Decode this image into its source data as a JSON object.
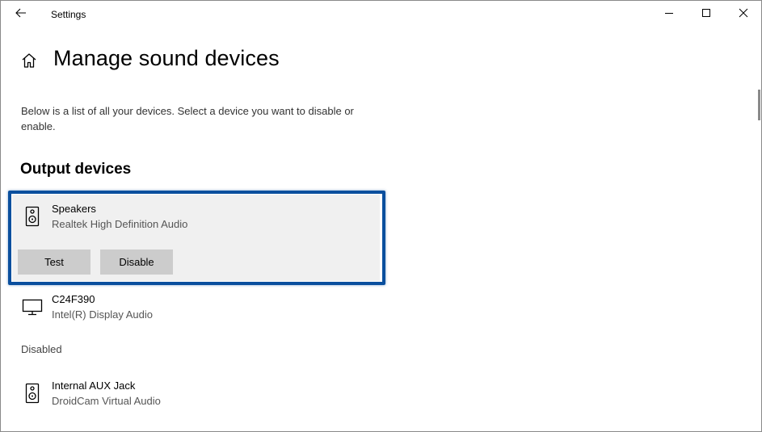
{
  "window": {
    "title": "Settings",
    "back_icon": "arrow-left-icon",
    "controls": [
      "minimize-icon",
      "maximize-icon",
      "close-icon"
    ]
  },
  "header": {
    "home_icon": "home-icon",
    "title": "Manage sound devices"
  },
  "description": "Below is a list of all your devices. Select a device you want to disable or enable.",
  "output": {
    "section_title": "Output devices",
    "devices": [
      {
        "name": "Speakers",
        "subtitle": "Realtek High Definition Audio",
        "icon": "speaker-icon",
        "selected": true,
        "buttons": {
          "test": "Test",
          "disable": "Disable"
        }
      },
      {
        "name": "C24F390",
        "subtitle": "Intel(R) Display Audio",
        "icon": "monitor-icon",
        "selected": false
      }
    ]
  },
  "disabled": {
    "label": "Disabled",
    "devices": [
      {
        "name": "Internal AUX Jack",
        "subtitle": "DroidCam Virtual Audio",
        "icon": "speaker-icon"
      }
    ]
  },
  "colors": {
    "highlight": "#0a4f9e",
    "selected_bg": "#f0f0f0",
    "button_bg": "#cccccc"
  }
}
